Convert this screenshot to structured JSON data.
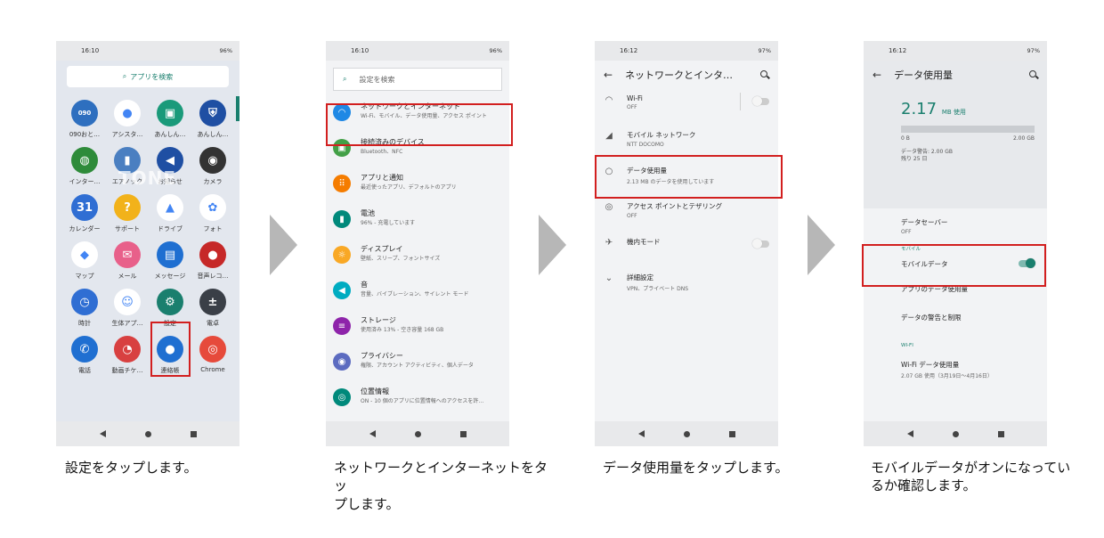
{
  "phones": {
    "p1": {
      "status": {
        "time": "16:10",
        "right": "96%"
      },
      "search_label": "アプリを検索",
      "watermark": "TONE",
      "apps": [
        {
          "label": "090おと…",
          "icon": "phone-090-icon",
          "color": "#2e6fbf",
          "glyph": "090"
        },
        {
          "label": "アシスタ…",
          "icon": "assistant-icon",
          "color": "#ffffff",
          "glyph": "●"
        },
        {
          "label": "あんしん…",
          "icon": "anshin-icon",
          "color": "#1a9a7a",
          "glyph": "▣"
        },
        {
          "label": "あんしん…",
          "icon": "shield-icon",
          "color": "#1f4fa3",
          "glyph": "⛨"
        },
        {
          "label": "インター…",
          "icon": "globe-icon",
          "color": "#2e8b3a",
          "glyph": "◍"
        },
        {
          "label": "エアノック",
          "icon": "airnock-icon",
          "color": "#4a7fc1",
          "glyph": "▮"
        },
        {
          "label": "お知らせ",
          "icon": "megaphone-icon",
          "color": "#1f4fa3",
          "glyph": "◀"
        },
        {
          "label": "カメラ",
          "icon": "camera-icon",
          "color": "#333333",
          "glyph": "◉"
        },
        {
          "label": "カレンダー",
          "icon": "calendar-icon",
          "color": "#2f6ed3",
          "glyph": "31"
        },
        {
          "label": "サポート",
          "icon": "support-icon",
          "color": "#f2b21a",
          "glyph": "?"
        },
        {
          "label": "ドライブ",
          "icon": "drive-icon",
          "color": "#ffffff",
          "glyph": "▲"
        },
        {
          "label": "フォト",
          "icon": "photos-icon",
          "color": "#ffffff",
          "glyph": "✿"
        },
        {
          "label": "マップ",
          "icon": "maps-icon",
          "color": "#ffffff",
          "glyph": "◆"
        },
        {
          "label": "メール",
          "icon": "mail-icon",
          "color": "#e8608a",
          "glyph": "✉"
        },
        {
          "label": "メッセージ",
          "icon": "message-icon",
          "color": "#1f6fd1",
          "glyph": "▤"
        },
        {
          "label": "音声レコ…",
          "icon": "recorder-icon",
          "color": "#c62828",
          "glyph": "●"
        },
        {
          "label": "時計",
          "icon": "clock-icon",
          "color": "#2f6ed3",
          "glyph": "◷"
        },
        {
          "label": "生体アプ…",
          "icon": "bio-app-icon",
          "color": "#ffffff",
          "glyph": "☺"
        },
        {
          "label": "設定",
          "icon": "gear-icon",
          "color": "#1a7f6e",
          "glyph": "⚙"
        },
        {
          "label": "電卓",
          "icon": "calculator-icon",
          "color": "#3a3f47",
          "glyph": "±"
        },
        {
          "label": "電話",
          "icon": "phone-icon",
          "color": "#1f6fd1",
          "glyph": "✆"
        },
        {
          "label": "動画チケ…",
          "icon": "video-ticket-icon",
          "color": "#d84040",
          "glyph": "◔"
        },
        {
          "label": "連絡帳",
          "icon": "contacts-icon",
          "color": "#1f6fd1",
          "glyph": "●"
        },
        {
          "label": "Chrome",
          "icon": "chrome-icon",
          "color": "#e64a3b",
          "glyph": "◎"
        }
      ]
    },
    "p2": {
      "status": {
        "time": "16:10",
        "right": "96%"
      },
      "search_placeholder": "設定を検索",
      "items": [
        {
          "title": "ネットワークとインターネット",
          "sub": "Wi-Fi、モバイル、データ使用量、アクセス ポイント",
          "icon": "wifi-icon",
          "color": "#1e88e5",
          "glyph": "◠"
        },
        {
          "title": "接続済みのデバイス",
          "sub": "Bluetooth、NFC",
          "icon": "devices-icon",
          "color": "#43a047",
          "glyph": "▣"
        },
        {
          "title": "アプリと通知",
          "sub": "最近使ったアプリ、デフォルトのアプリ",
          "icon": "apps-icon",
          "color": "#f57c00",
          "glyph": "⠿"
        },
        {
          "title": "電池",
          "sub": "96% - 充電しています",
          "icon": "battery-icon",
          "color": "#00897b",
          "glyph": "▮"
        },
        {
          "title": "ディスプレイ",
          "sub": "壁紙、スリープ、フォントサイズ",
          "icon": "display-icon",
          "color": "#f9a825",
          "glyph": "☼"
        },
        {
          "title": "音",
          "sub": "音量、バイブレーション、サイレント モード",
          "icon": "sound-icon",
          "color": "#00acc1",
          "glyph": "◀"
        },
        {
          "title": "ストレージ",
          "sub": "使用済み 13% - 空き容量 168 GB",
          "icon": "storage-icon",
          "color": "#8e24aa",
          "glyph": "≡"
        },
        {
          "title": "プライバシー",
          "sub": "権限、アカウント アクティビティ、個人データ",
          "icon": "privacy-icon",
          "color": "#5c6bc0",
          "glyph": "◉"
        },
        {
          "title": "位置情報",
          "sub": "ON - 10 個のアプリに位置情報へのアクセスを許…",
          "icon": "location-icon",
          "color": "#00897b",
          "glyph": "◎"
        }
      ]
    },
    "p3": {
      "status": {
        "time": "16:12",
        "right": "97%"
      },
      "title": "ネットワークとインタ…",
      "items": [
        {
          "title": "Wi-Fi",
          "sub": "OFF",
          "icon": "wifi-icon",
          "glyph": "◠",
          "toggle": "off"
        },
        {
          "title": "モバイル ネットワーク",
          "sub": "NTT DOCOMO",
          "icon": "signal-icon",
          "glyph": "◢"
        },
        {
          "title": "データ使用量",
          "sub": "2.13 MB のデータを使用しています",
          "icon": "data-usage-icon",
          "glyph": "○"
        },
        {
          "title": "アクセス ポイントとテザリング",
          "sub": "OFF",
          "icon": "hotspot-icon",
          "glyph": "◎"
        },
        {
          "title": "機内モード",
          "sub": "",
          "icon": "airplane-icon",
          "glyph": "✈",
          "toggle": "off"
        },
        {
          "title": "詳細設定",
          "sub": "VPN、プライベート DNS",
          "icon": "chevron-down-icon",
          "glyph": "⌄"
        }
      ]
    },
    "p4": {
      "status": {
        "time": "16:12",
        "right": "97%"
      },
      "title": "データ使用量",
      "used_value": "2.17",
      "used_unit": "MB 使用",
      "range_min": "0 B",
      "range_max": "2.00 GB",
      "warning": "データ警告: 2.00 GB",
      "days_left": "残り 25 日",
      "saver_title": "データセーバー",
      "saver_sub": "OFF",
      "mobile_section": "モバイル",
      "mobile_data_label": "モバイルデータ",
      "mobile_data_on": true,
      "app_data_label": "アプリのデータ使用量",
      "warn_limit_label": "データの警告と制限",
      "wifi_section": "WI-FI",
      "wifi_usage_title": "Wi-Fi データ使用量",
      "wifi_usage_sub": "2.07 GB 使用（3月19日〜4月16日）"
    }
  },
  "captions": [
    "設定をタップします。",
    "ネットワークとインターネットをタッ\nプします。",
    "データ使用量をタップします。",
    "モバイルデータがオンになってい\nるか確認します。"
  ],
  "highlight_color": "#d21f1f"
}
